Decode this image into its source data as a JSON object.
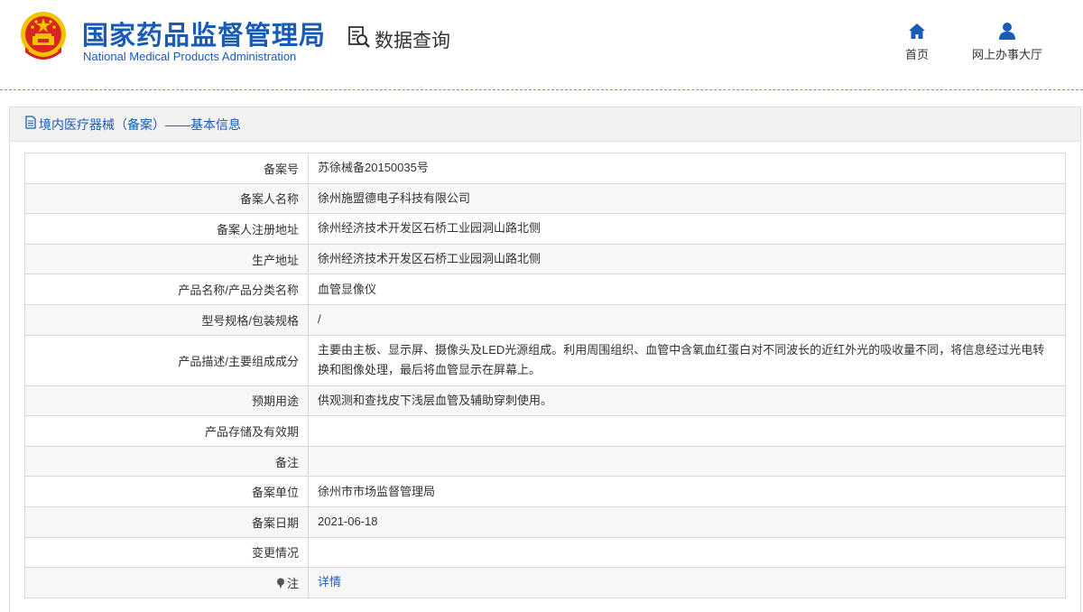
{
  "header": {
    "org_name_cn": "国家药品监督管理局",
    "org_name_en": "National Medical Products Administration",
    "query_label": "数据查询",
    "nav": {
      "home_label": "首页",
      "hall_label": "网上办事大厅"
    }
  },
  "panel": {
    "title": "境内医疗器械（备案）——基本信息"
  },
  "rows": [
    {
      "label": "备案号",
      "value": "苏徐械备20150035号"
    },
    {
      "label": "备案人名称",
      "value": "徐州施盟德电子科技有限公司"
    },
    {
      "label": "备案人注册地址",
      "value": "徐州经济技术开发区石桥工业园洞山路北侧"
    },
    {
      "label": "生产地址",
      "value": "徐州经济技术开发区石桥工业园洞山路北侧"
    },
    {
      "label": "产品名称/产品分类名称",
      "value": "血管显像仪"
    },
    {
      "label": "型号规格/包装规格",
      "value": "/"
    },
    {
      "label": "产品描述/主要组成成分",
      "value": "主要由主板、显示屏、摄像头及LED光源组成。利用周围组织、血管中含氧血红蛋白对不同波长的近红外光的吸收量不同，将信息经过光电转换和图像处理，最后将血管显示在屏幕上。"
    },
    {
      "label": "预期用途",
      "value": "供观测和查找皮下浅层血管及辅助穿刺使用。"
    },
    {
      "label": "产品存储及有效期",
      "value": ""
    },
    {
      "label": "备注",
      "value": ""
    },
    {
      "label": "备案单位",
      "value": "徐州市市场监督管理局"
    },
    {
      "label": "备案日期",
      "value": "2021-06-18"
    },
    {
      "label": "变更情况",
      "value": ""
    },
    {
      "label": "注",
      "value": "详情"
    }
  ],
  "icons": {
    "emblem": "national-emblem-icon",
    "query": "document-search-icon",
    "home": "home-icon",
    "hall": "user-icon",
    "title": "document-icon",
    "note": "pin-icon"
  },
  "colors": {
    "brand_blue": "#1a5bb5",
    "emblem_red": "#d7261e",
    "emblem_gold": "#f2c200"
  }
}
